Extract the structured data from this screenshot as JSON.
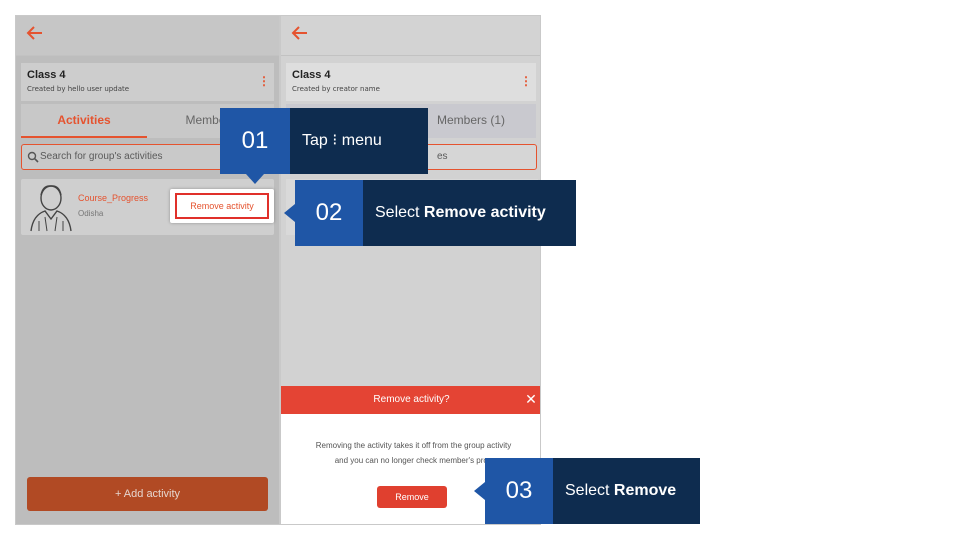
{
  "left_screen": {
    "class_title": "Class 4",
    "class_subtitle": "Created by hello user update",
    "kebab_glyph": "⋮",
    "tabs": [
      {
        "label": "Activities"
      },
      {
        "label": "Members"
      }
    ],
    "search_placeholder": "Search for group's activities",
    "activity": {
      "name": "Course_Progress",
      "subtitle": "Odisha"
    },
    "remove_popup_label": "Remove activity",
    "add_button_label": "+ Add activity"
  },
  "right_screen": {
    "class_title": "Class 4",
    "class_subtitle": "Created by creator name",
    "kebab_glyph": "⋮",
    "members_tab_label": "Members (1)",
    "search_placeholder_fragment": "es",
    "sheet": {
      "title": "Remove activity?",
      "close_glyph": "✕",
      "body_line1": "Removing the activity takes it off from the group activity",
      "body_line2": "and you can no longer check member's prog",
      "remove_button_label": "Remove"
    }
  },
  "callouts": [
    {
      "number": "01",
      "text_prefix": "Tap ",
      "text_icon": "⁝",
      "text_suffix": " menu"
    },
    {
      "number": "02",
      "text_prefix": "Select ",
      "text_bold": "Remove activity"
    },
    {
      "number": "03",
      "text_prefix": "Select ",
      "text_bold": "Remove"
    }
  ],
  "colors": {
    "accent": "#e5532f",
    "callout_number_bg": "#1f56a6",
    "callout_text_bg": "#0e2c4f",
    "sheet_header": "#e44434",
    "add_button": "#b14a24"
  },
  "icons": {
    "back": "back-arrow-icon",
    "kebab": "kebab-menu-icon",
    "search": "search-icon",
    "close": "close-icon",
    "avatar": "user-avatar-icon"
  }
}
